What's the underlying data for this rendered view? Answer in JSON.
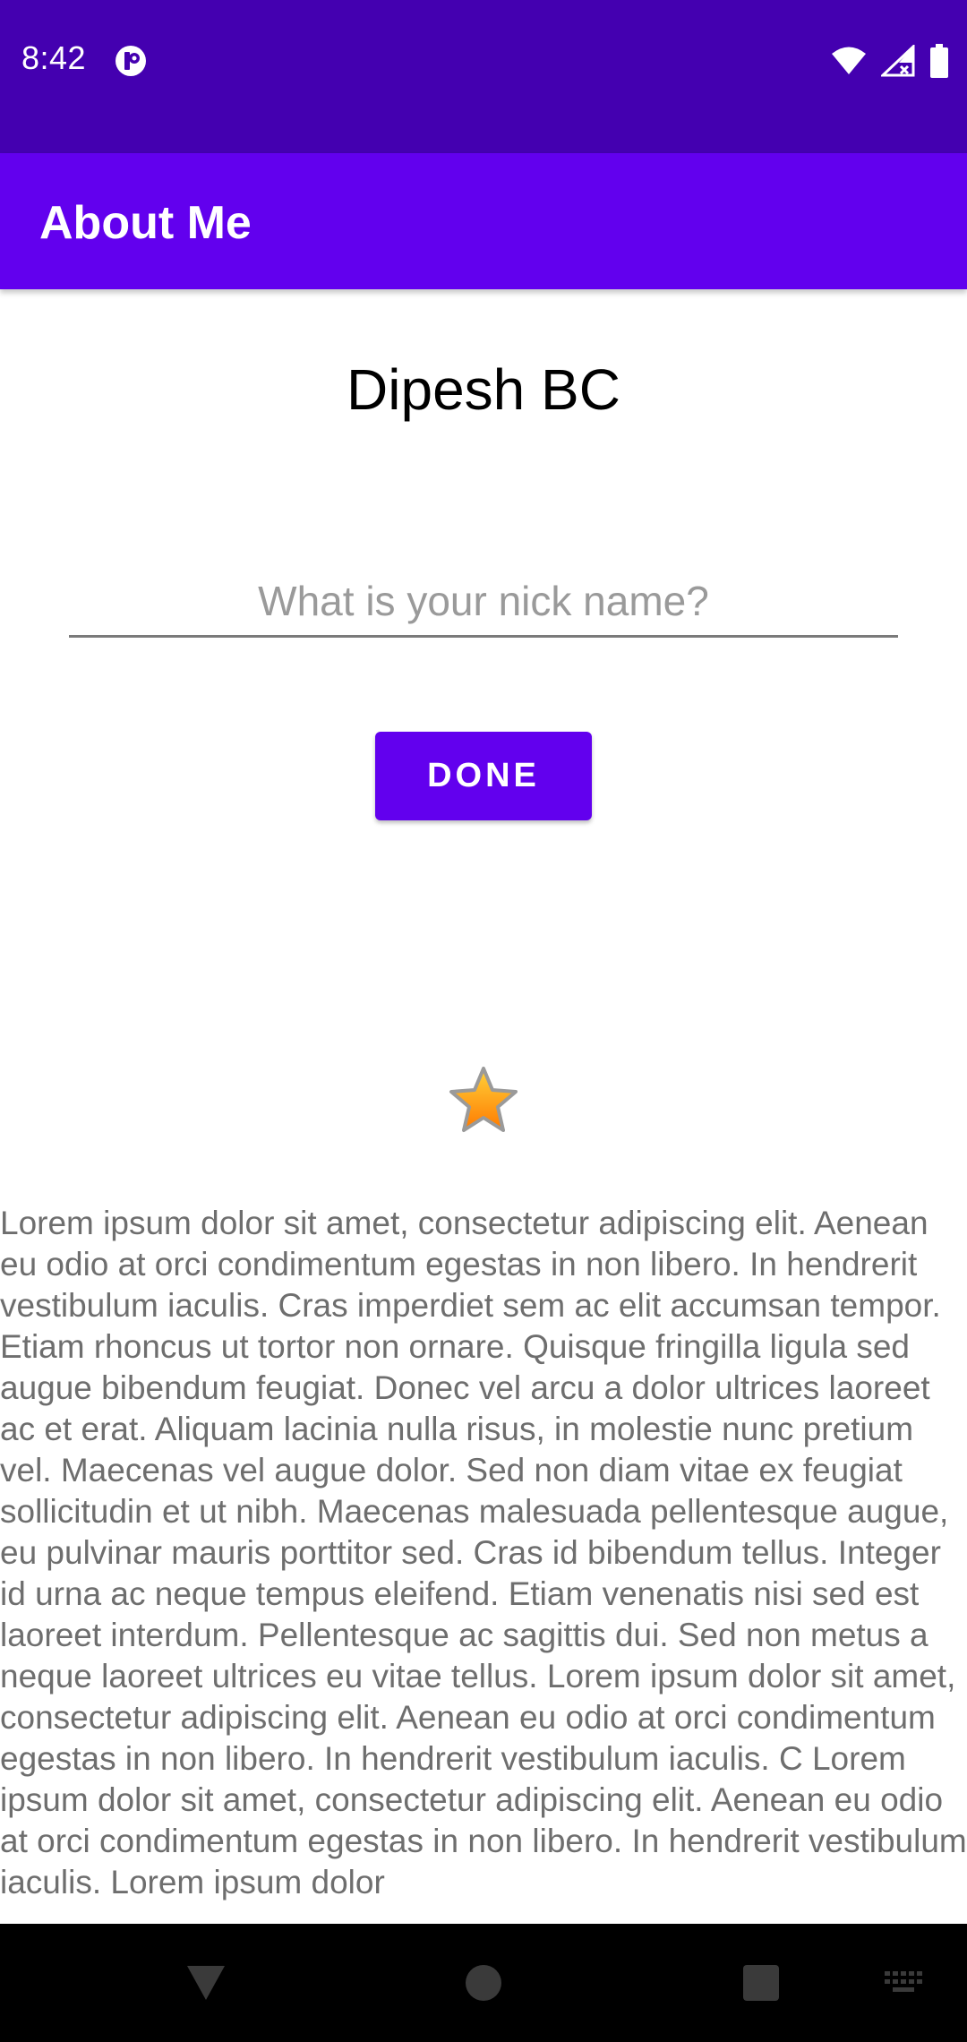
{
  "status_bar": {
    "time": "8:42",
    "background": "#4400b0",
    "icons": [
      "app-notification-icon",
      "wifi-icon",
      "signal-icon",
      "battery-icon"
    ]
  },
  "app_bar": {
    "title": "About Me",
    "background": "#6200ee"
  },
  "profile": {
    "name": "Dipesh BC"
  },
  "nickname_input": {
    "value": "",
    "placeholder": "What is your nick name?"
  },
  "done_button": {
    "label": "DONE",
    "color": "#6200ee"
  },
  "star": {
    "icon": "star-icon"
  },
  "bio": {
    "text": "Lorem ipsum dolor sit amet, consectetur adipiscing elit. Aenean eu odio at orci condimentum egestas in non libero. In hendrerit vestibulum iaculis. Cras imperdiet sem ac elit accumsan tempor. Etiam rhoncus ut tortor non ornare. Quisque fringilla ligula sed augue bibendum feugiat. Donec vel arcu a dolor ultrices laoreet ac et erat. Aliquam lacinia nulla risus, in molestie nunc pretium vel. Maecenas vel augue dolor. Sed non diam vitae ex feugiat sollicitudin et ut nibh. Maecenas malesuada pellentesque augue, eu pulvinar mauris porttitor sed. Cras id bibendum tellus. Integer id urna ac neque tempus eleifend. Etiam venenatis nisi sed est laoreet interdum. Pellentesque ac sagittis dui. Sed non metus a neque laoreet ultrices eu vitae tellus. Lorem ipsum dolor sit amet, consectetur adipiscing elit. Aenean eu odio at orci condimentum egestas in non libero. In hendrerit vestibulum iaculis. C Lorem ipsum dolor sit amet, consectetur adipiscing elit. Aenean eu odio at orci condimentum egestas in non libero. In hendrerit vestibulum iaculis. Lorem ipsum dolor",
    "color": "#6e6e6e"
  },
  "nav_bar": {
    "buttons": [
      "back-icon",
      "home-icon",
      "recents-icon",
      "keyboard-icon"
    ]
  }
}
